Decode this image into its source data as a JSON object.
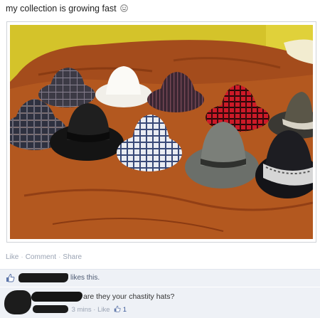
{
  "post": {
    "status_text": "my collection is growing fast",
    "emoticon": "smiley-icon"
  },
  "actions": {
    "like": "Like",
    "comment": "Comment",
    "share": "Share",
    "separator": "·"
  },
  "likes": {
    "text": "likes this."
  },
  "comment": {
    "text": "are they your chastity hats?",
    "time": "3 mins",
    "like": "Like",
    "like_count": "1"
  },
  "colors": {
    "link": "#3b5998",
    "muted": "#9aa3b3",
    "panel_bg": "#eef1f6"
  }
}
